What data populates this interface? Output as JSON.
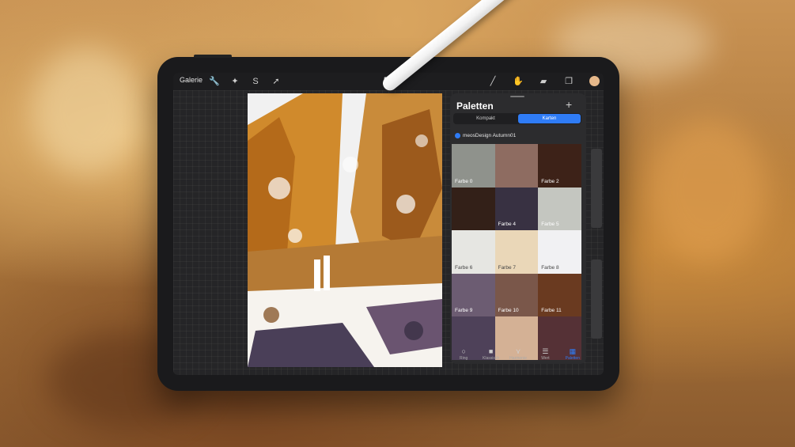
{
  "topbar": {
    "gallery_label": "Galerie",
    "menu_dots": "•••",
    "tool_icons": [
      "wrench-icon",
      "magic-wand-icon",
      "selection-icon",
      "transform-icon"
    ],
    "right_tool_icons": [
      "brush-icon",
      "smudge-icon",
      "eraser-icon",
      "layers-icon"
    ],
    "current_color": "#e6b88a"
  },
  "palettes": {
    "title": "Paletten",
    "add_symbol": "+",
    "view_modes": [
      {
        "label": "Kompakt",
        "active": false
      },
      {
        "label": "Karten",
        "active": true
      }
    ],
    "palette_name": "meosDesign Autumn01",
    "swatches": [
      {
        "label": "Farbe 0",
        "color": "#8f928c",
        "text": "#ffffff"
      },
      {
        "label": "",
        "color": "#8e6c61",
        "text": "#ffffff"
      },
      {
        "label": "Farbe 2",
        "color": "#3d2218",
        "text": "#ffffff"
      },
      {
        "label": "",
        "color": "#332018",
        "text": "#ffffff"
      },
      {
        "label": "Farbe 4",
        "color": "#383142",
        "text": "#ffffff"
      },
      {
        "label": "Farbe 5",
        "color": "#c4c6c0",
        "text": "#ffffff"
      },
      {
        "label": "Farbe 6",
        "color": "#e6e6e2",
        "text": "#444444"
      },
      {
        "label": "Farbe 7",
        "color": "#ead7b8",
        "text": "#444444"
      },
      {
        "label": "Farbe 8",
        "color": "#f1f1f3",
        "text": "#444444"
      },
      {
        "label": "Farbe 9",
        "color": "#6c5c72",
        "text": "#ffffff"
      },
      {
        "label": "Farbe 10",
        "color": "#7a574a",
        "text": "#ffffff"
      },
      {
        "label": "Farbe 11",
        "color": "#6a3a20",
        "text": "#ffffff"
      },
      {
        "label": "",
        "color": "#4e4159",
        "text": "#ffffff"
      },
      {
        "label": "",
        "color": "#d4b195",
        "text": "#444444"
      },
      {
        "label": "",
        "color": "#553136",
        "text": "#ffffff"
      }
    ],
    "tabs": [
      {
        "label": "Ring",
        "icon": "○",
        "active": false
      },
      {
        "label": "Klassisch",
        "icon": "■",
        "active": false
      },
      {
        "label": "Harmonie",
        "icon": "⋎",
        "active": false
      },
      {
        "label": "Wert",
        "icon": "☰",
        "active": false
      },
      {
        "label": "Paletten",
        "icon": "▦",
        "active": true
      }
    ]
  }
}
